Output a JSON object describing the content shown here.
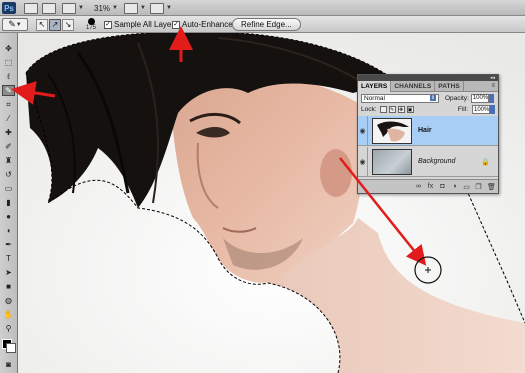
{
  "app_bar": {
    "logo": "Ps",
    "zoom": "31%"
  },
  "options_bar": {
    "brush_size": "175",
    "sample_all_layers": "Sample All Layers",
    "auto_enhance": "Auto-Enhance",
    "refine_edge": "Refine Edge..."
  },
  "layers_panel": {
    "tabs": [
      "LAYERS",
      "CHANNELS",
      "PATHS"
    ],
    "blend_mode": "Normal",
    "opacity_label": "Opacity:",
    "opacity_value": "100%",
    "lock_label": "Lock:",
    "fill_label": "Fill:",
    "fill_value": "100%",
    "layers": [
      {
        "name": "Hair"
      },
      {
        "name": "Background"
      }
    ]
  },
  "colors": {
    "selected_layer": "#a8cef5",
    "annotation_arrow": "#e21b1b",
    "background_swatch": "#ffffff",
    "foreground_swatch": "#000000"
  }
}
